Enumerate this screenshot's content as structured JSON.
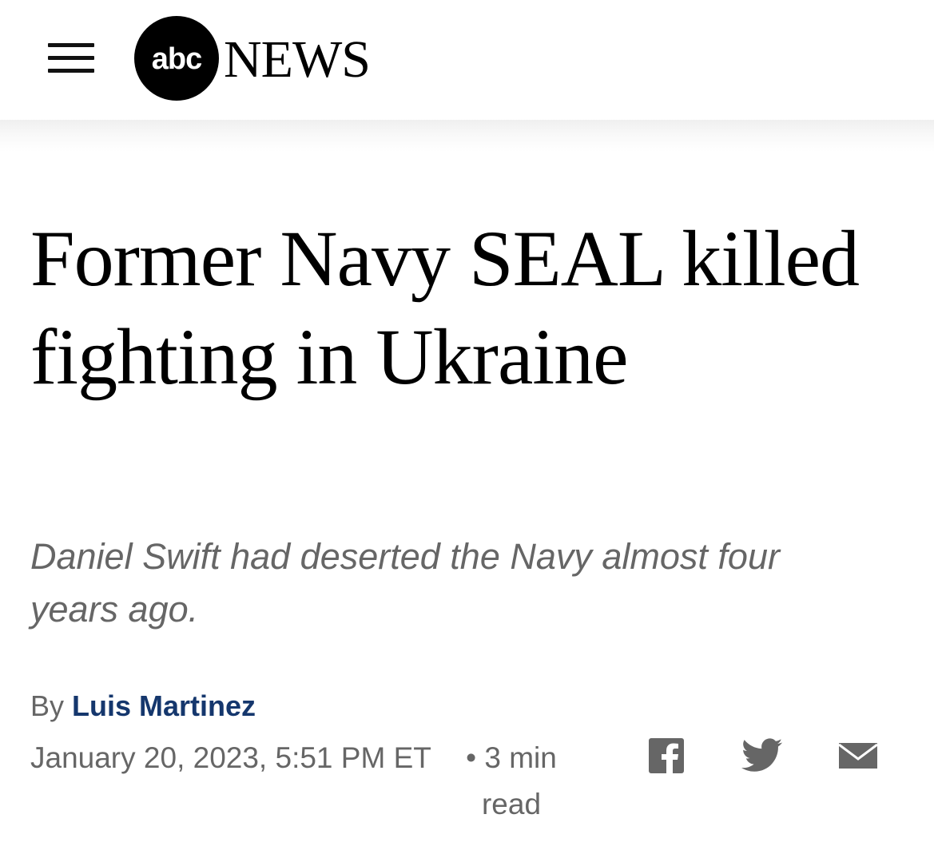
{
  "header": {
    "logo": {
      "abc_text": "abc",
      "news_text": "NEWS"
    }
  },
  "article": {
    "headline": "Former Navy SEAL killed fighting in Ukraine",
    "subheadline": "Daniel Swift had deserted the Navy almost four years ago.",
    "byline_prefix": "By",
    "author": "Luis Martinez",
    "date": "January 20, 2023, 5:51 PM ET",
    "read_time": "• 3 min read"
  },
  "share": {
    "icons": [
      "facebook-icon",
      "twitter-icon",
      "email-icon"
    ]
  },
  "colors": {
    "author_link": "#15376d",
    "meta_text": "#666666",
    "icon_gray": "#666666"
  }
}
